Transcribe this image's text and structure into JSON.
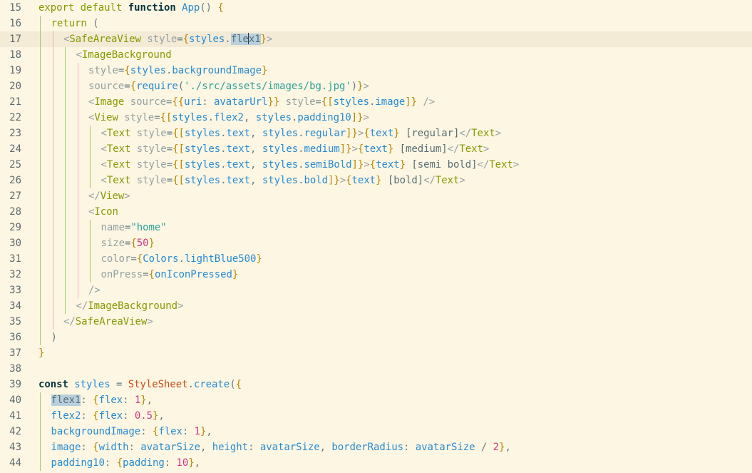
{
  "editor": {
    "lines": [
      {
        "n": "15",
        "tokens": [
          [
            "kw",
            "export"
          ],
          [
            "sp",
            " "
          ],
          [
            "kw",
            "default"
          ],
          [
            "sp",
            " "
          ],
          [
            "kwb",
            "function"
          ],
          [
            "sp",
            " "
          ],
          [
            "fn",
            "App"
          ],
          [
            "pn",
            "() "
          ],
          [
            "br",
            "{"
          ]
        ]
      },
      {
        "n": "16",
        "tokens": [
          [
            "kw",
            "return"
          ],
          [
            "sp",
            " "
          ],
          [
            "pn",
            "("
          ]
        ]
      },
      {
        "n": "17",
        "tokens": [
          [
            "ang",
            "<"
          ],
          [
            "tag",
            "SafeAreaView"
          ],
          [
            "sp",
            " "
          ],
          [
            "at",
            "style"
          ],
          [
            "pn",
            "="
          ],
          [
            "br",
            "{"
          ],
          [
            "id",
            "styles"
          ],
          [
            "pn",
            "."
          ],
          [
            "sel",
            "fle"
          ],
          [
            "caret",
            ""
          ],
          [
            "sel",
            "x1"
          ],
          [
            "br",
            "}"
          ],
          [
            "ang",
            ">"
          ]
        ]
      },
      {
        "n": "18",
        "tokens": [
          [
            "ang",
            "<"
          ],
          [
            "tag",
            "ImageBackground"
          ]
        ]
      },
      {
        "n": "19",
        "tokens": [
          [
            "at",
            "style"
          ],
          [
            "pn",
            "="
          ],
          [
            "br",
            "{"
          ],
          [
            "id",
            "styles"
          ],
          [
            "pn",
            "."
          ],
          [
            "id",
            "backgroundImage"
          ],
          [
            "br",
            "}"
          ]
        ]
      },
      {
        "n": "20",
        "tokens": [
          [
            "at",
            "source"
          ],
          [
            "pn",
            "="
          ],
          [
            "br",
            "{"
          ],
          [
            "fn",
            "require"
          ],
          [
            "pn",
            "("
          ],
          [
            "str",
            "'./src/assets/images/bg.jpg'"
          ],
          [
            "pn",
            ")"
          ],
          [
            "br",
            "}"
          ],
          [
            "ang",
            ">"
          ]
        ]
      },
      {
        "n": "21",
        "tokens": [
          [
            "ang",
            "<"
          ],
          [
            "tag",
            "Image"
          ],
          [
            "sp",
            " "
          ],
          [
            "at",
            "source"
          ],
          [
            "pn",
            "="
          ],
          [
            "br",
            "{{"
          ],
          [
            "id",
            "uri"
          ],
          [
            "pn",
            ": "
          ],
          [
            "id",
            "avatarUrl"
          ],
          [
            "br",
            "}}"
          ],
          [
            "sp",
            " "
          ],
          [
            "at",
            "style"
          ],
          [
            "pn",
            "="
          ],
          [
            "br",
            "{["
          ],
          [
            "id",
            "styles"
          ],
          [
            "pn",
            "."
          ],
          [
            "id",
            "image"
          ],
          [
            "br",
            "]}"
          ],
          [
            "sp",
            " "
          ],
          [
            "ang",
            "/>"
          ]
        ]
      },
      {
        "n": "22",
        "tokens": [
          [
            "ang",
            "<"
          ],
          [
            "tag",
            "View"
          ],
          [
            "sp",
            " "
          ],
          [
            "at",
            "style"
          ],
          [
            "pn",
            "="
          ],
          [
            "br",
            "{["
          ],
          [
            "id",
            "styles"
          ],
          [
            "pn",
            "."
          ],
          [
            "id",
            "flex2"
          ],
          [
            "pn",
            ", "
          ],
          [
            "id",
            "styles"
          ],
          [
            "pn",
            "."
          ],
          [
            "id",
            "padding10"
          ],
          [
            "br",
            "]}"
          ],
          [
            "ang",
            ">"
          ]
        ]
      },
      {
        "n": "23",
        "tokens": [
          [
            "ang",
            "<"
          ],
          [
            "tag",
            "Text"
          ],
          [
            "sp",
            " "
          ],
          [
            "at",
            "style"
          ],
          [
            "pn",
            "="
          ],
          [
            "br",
            "{["
          ],
          [
            "id",
            "styles"
          ],
          [
            "pn",
            "."
          ],
          [
            "id",
            "text"
          ],
          [
            "pn",
            ", "
          ],
          [
            "id",
            "styles"
          ],
          [
            "pn",
            "."
          ],
          [
            "id",
            "regular"
          ],
          [
            "br",
            "]}"
          ],
          [
            "ang",
            ">"
          ],
          [
            "br",
            "{"
          ],
          [
            "id",
            "text"
          ],
          [
            "br",
            "}"
          ],
          [
            "txt",
            " [regular]"
          ],
          [
            "ang",
            "</"
          ],
          [
            "tag",
            "Text"
          ],
          [
            "ang",
            ">"
          ]
        ]
      },
      {
        "n": "24",
        "tokens": [
          [
            "ang",
            "<"
          ],
          [
            "tag",
            "Text"
          ],
          [
            "sp",
            " "
          ],
          [
            "at",
            "style"
          ],
          [
            "pn",
            "="
          ],
          [
            "br",
            "{["
          ],
          [
            "id",
            "styles"
          ],
          [
            "pn",
            "."
          ],
          [
            "id",
            "text"
          ],
          [
            "pn",
            ", "
          ],
          [
            "id",
            "styles"
          ],
          [
            "pn",
            "."
          ],
          [
            "id",
            "medium"
          ],
          [
            "br",
            "]}"
          ],
          [
            "ang",
            ">"
          ],
          [
            "br",
            "{"
          ],
          [
            "id",
            "text"
          ],
          [
            "br",
            "}"
          ],
          [
            "txt",
            " [medium]"
          ],
          [
            "ang",
            "</"
          ],
          [
            "tag",
            "Text"
          ],
          [
            "ang",
            ">"
          ]
        ]
      },
      {
        "n": "25",
        "tokens": [
          [
            "ang",
            "<"
          ],
          [
            "tag",
            "Text"
          ],
          [
            "sp",
            " "
          ],
          [
            "at",
            "style"
          ],
          [
            "pn",
            "="
          ],
          [
            "br",
            "{["
          ],
          [
            "id",
            "styles"
          ],
          [
            "pn",
            "."
          ],
          [
            "id",
            "text"
          ],
          [
            "pn",
            ", "
          ],
          [
            "id",
            "styles"
          ],
          [
            "pn",
            "."
          ],
          [
            "id",
            "semiBold"
          ],
          [
            "br",
            "]}"
          ],
          [
            "ang",
            ">"
          ],
          [
            "br",
            "{"
          ],
          [
            "id",
            "text"
          ],
          [
            "br",
            "}"
          ],
          [
            "txt",
            " [semi bold]"
          ],
          [
            "ang",
            "</"
          ],
          [
            "tag",
            "Text"
          ],
          [
            "ang",
            ">"
          ]
        ]
      },
      {
        "n": "26",
        "tokens": [
          [
            "ang",
            "<"
          ],
          [
            "tag",
            "Text"
          ],
          [
            "sp",
            " "
          ],
          [
            "at",
            "style"
          ],
          [
            "pn",
            "="
          ],
          [
            "br",
            "{["
          ],
          [
            "id",
            "styles"
          ],
          [
            "pn",
            "."
          ],
          [
            "id",
            "text"
          ],
          [
            "pn",
            ", "
          ],
          [
            "id",
            "styles"
          ],
          [
            "pn",
            "."
          ],
          [
            "id",
            "bold"
          ],
          [
            "br",
            "]}"
          ],
          [
            "ang",
            ">"
          ],
          [
            "br",
            "{"
          ],
          [
            "id",
            "text"
          ],
          [
            "br",
            "}"
          ],
          [
            "txt",
            " [bold]"
          ],
          [
            "ang",
            "</"
          ],
          [
            "tag",
            "Text"
          ],
          [
            "ang",
            ">"
          ]
        ]
      },
      {
        "n": "27",
        "tokens": [
          [
            "ang",
            "</"
          ],
          [
            "tag",
            "View"
          ],
          [
            "ang",
            ">"
          ]
        ]
      },
      {
        "n": "28",
        "tokens": [
          [
            "ang",
            "<"
          ],
          [
            "tag",
            "Icon"
          ]
        ]
      },
      {
        "n": "29",
        "tokens": [
          [
            "at",
            "name"
          ],
          [
            "pn",
            "="
          ],
          [
            "str",
            "\"home\""
          ]
        ]
      },
      {
        "n": "30",
        "tokens": [
          [
            "at",
            "size"
          ],
          [
            "pn",
            "="
          ],
          [
            "br",
            "{"
          ],
          [
            "num",
            "50"
          ],
          [
            "br",
            "}"
          ]
        ]
      },
      {
        "n": "31",
        "tokens": [
          [
            "at",
            "color"
          ],
          [
            "pn",
            "="
          ],
          [
            "br",
            "{"
          ],
          [
            "id",
            "Colors"
          ],
          [
            "pn",
            "."
          ],
          [
            "id",
            "lightBlue500"
          ],
          [
            "br",
            "}"
          ]
        ]
      },
      {
        "n": "32",
        "tokens": [
          [
            "at",
            "onPress"
          ],
          [
            "pn",
            "="
          ],
          [
            "br",
            "{"
          ],
          [
            "id",
            "onIconPressed"
          ],
          [
            "br",
            "}"
          ]
        ]
      },
      {
        "n": "33",
        "tokens": [
          [
            "ang",
            "/>"
          ]
        ]
      },
      {
        "n": "34",
        "tokens": [
          [
            "ang",
            "</"
          ],
          [
            "tag",
            "ImageBackground"
          ],
          [
            "ang",
            ">"
          ]
        ]
      },
      {
        "n": "35",
        "tokens": [
          [
            "ang",
            "</"
          ],
          [
            "tag",
            "SafeAreaView"
          ],
          [
            "ang",
            ">"
          ]
        ]
      },
      {
        "n": "36",
        "tokens": [
          [
            "pn",
            ")"
          ]
        ]
      },
      {
        "n": "37",
        "tokens": [
          [
            "br",
            "}"
          ]
        ]
      },
      {
        "n": "38",
        "tokens": []
      },
      {
        "n": "39",
        "tokens": [
          [
            "kwb",
            "const"
          ],
          [
            "sp",
            " "
          ],
          [
            "id",
            "styles"
          ],
          [
            "pn",
            " = "
          ],
          [
            "cls",
            "StyleSheet"
          ],
          [
            "pn",
            "."
          ],
          [
            "fn",
            "create"
          ],
          [
            "pn",
            "("
          ],
          [
            "br",
            "{"
          ]
        ]
      },
      {
        "n": "40",
        "tokens": [
          [
            "sel",
            "flex1"
          ],
          [
            "pn",
            ": "
          ],
          [
            "br",
            "{"
          ],
          [
            "id",
            "flex"
          ],
          [
            "pn",
            ": "
          ],
          [
            "num",
            "1"
          ],
          [
            "br",
            "}"
          ],
          [
            "pn",
            ","
          ]
        ]
      },
      {
        "n": "41",
        "tokens": [
          [
            "id",
            "flex2"
          ],
          [
            "pn",
            ": "
          ],
          [
            "br",
            "{"
          ],
          [
            "id",
            "flex"
          ],
          [
            "pn",
            ": "
          ],
          [
            "num",
            "0.5"
          ],
          [
            "br",
            "}"
          ],
          [
            "pn",
            ","
          ]
        ]
      },
      {
        "n": "42",
        "tokens": [
          [
            "id",
            "backgroundImage"
          ],
          [
            "pn",
            ": "
          ],
          [
            "br",
            "{"
          ],
          [
            "id",
            "flex"
          ],
          [
            "pn",
            ": "
          ],
          [
            "num",
            "1"
          ],
          [
            "br",
            "}"
          ],
          [
            "pn",
            ","
          ]
        ]
      },
      {
        "n": "43",
        "tokens": [
          [
            "id",
            "image"
          ],
          [
            "pn",
            ": "
          ],
          [
            "br",
            "{"
          ],
          [
            "id",
            "width"
          ],
          [
            "pn",
            ": "
          ],
          [
            "id",
            "avatarSize"
          ],
          [
            "pn",
            ", "
          ],
          [
            "id",
            "height"
          ],
          [
            "pn",
            ": "
          ],
          [
            "id",
            "avatarSize"
          ],
          [
            "pn",
            ", "
          ],
          [
            "id",
            "borderRadius"
          ],
          [
            "pn",
            ": "
          ],
          [
            "id",
            "avatarSize"
          ],
          [
            "pn",
            " / "
          ],
          [
            "num",
            "2"
          ],
          [
            "br",
            "}"
          ],
          [
            "pn",
            ","
          ]
        ]
      },
      {
        "n": "44",
        "tokens": [
          [
            "id",
            "padding10"
          ],
          [
            "pn",
            ": "
          ],
          [
            "br",
            "{"
          ],
          [
            "id",
            "padding"
          ],
          [
            "pn",
            ": "
          ],
          [
            "num",
            "10"
          ],
          [
            "br",
            "}"
          ],
          [
            "pn",
            ","
          ]
        ]
      }
    ]
  }
}
